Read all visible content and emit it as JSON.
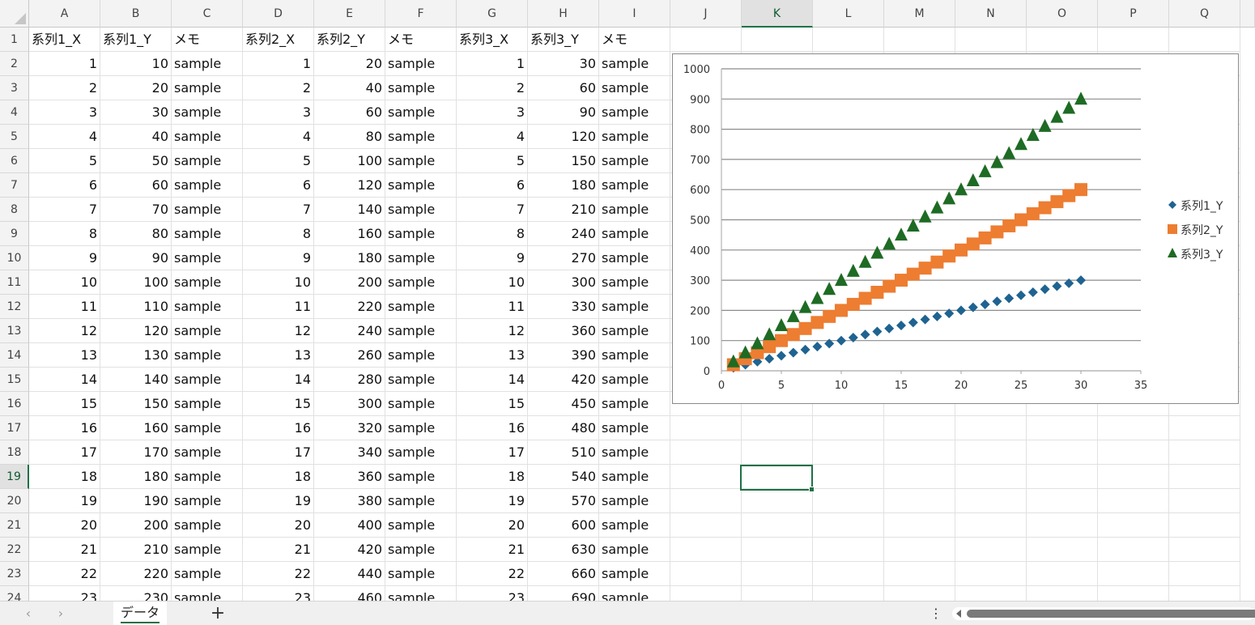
{
  "columns": [
    "A",
    "B",
    "C",
    "D",
    "E",
    "F",
    "G",
    "H",
    "I",
    "J",
    "K",
    "L",
    "M",
    "N",
    "O",
    "P",
    "Q"
  ],
  "selected_column": "K",
  "selected_row": "19",
  "rows": [
    {
      "row": "1",
      "cells": [
        "系列1_X",
        "系列1_Y",
        "メモ",
        "系列2_X",
        "系列2_Y",
        "メモ",
        "系列3_X",
        "系列3_Y",
        "メモ"
      ]
    },
    {
      "row": "2",
      "cells": [
        "1",
        "10",
        "sample",
        "1",
        "20",
        "sample",
        "1",
        "30",
        "sample"
      ]
    },
    {
      "row": "3",
      "cells": [
        "2",
        "20",
        "sample",
        "2",
        "40",
        "sample",
        "2",
        "60",
        "sample"
      ]
    },
    {
      "row": "4",
      "cells": [
        "3",
        "30",
        "sample",
        "3",
        "60",
        "sample",
        "3",
        "90",
        "sample"
      ]
    },
    {
      "row": "5",
      "cells": [
        "4",
        "40",
        "sample",
        "4",
        "80",
        "sample",
        "4",
        "120",
        "sample"
      ]
    },
    {
      "row": "6",
      "cells": [
        "5",
        "50",
        "sample",
        "5",
        "100",
        "sample",
        "5",
        "150",
        "sample"
      ]
    },
    {
      "row": "7",
      "cells": [
        "6",
        "60",
        "sample",
        "6",
        "120",
        "sample",
        "6",
        "180",
        "sample"
      ]
    },
    {
      "row": "8",
      "cells": [
        "7",
        "70",
        "sample",
        "7",
        "140",
        "sample",
        "7",
        "210",
        "sample"
      ]
    },
    {
      "row": "9",
      "cells": [
        "8",
        "80",
        "sample",
        "8",
        "160",
        "sample",
        "8",
        "240",
        "sample"
      ]
    },
    {
      "row": "10",
      "cells": [
        "9",
        "90",
        "sample",
        "9",
        "180",
        "sample",
        "9",
        "270",
        "sample"
      ]
    },
    {
      "row": "11",
      "cells": [
        "10",
        "100",
        "sample",
        "10",
        "200",
        "sample",
        "10",
        "300",
        "sample"
      ]
    },
    {
      "row": "12",
      "cells": [
        "11",
        "110",
        "sample",
        "11",
        "220",
        "sample",
        "11",
        "330",
        "sample"
      ]
    },
    {
      "row": "13",
      "cells": [
        "12",
        "120",
        "sample",
        "12",
        "240",
        "sample",
        "12",
        "360",
        "sample"
      ]
    },
    {
      "row": "14",
      "cells": [
        "13",
        "130",
        "sample",
        "13",
        "260",
        "sample",
        "13",
        "390",
        "sample"
      ]
    },
    {
      "row": "15",
      "cells": [
        "14",
        "140",
        "sample",
        "14",
        "280",
        "sample",
        "14",
        "420",
        "sample"
      ]
    },
    {
      "row": "16",
      "cells": [
        "15",
        "150",
        "sample",
        "15",
        "300",
        "sample",
        "15",
        "450",
        "sample"
      ]
    },
    {
      "row": "17",
      "cells": [
        "16",
        "160",
        "sample",
        "16",
        "320",
        "sample",
        "16",
        "480",
        "sample"
      ]
    },
    {
      "row": "18",
      "cells": [
        "17",
        "170",
        "sample",
        "17",
        "340",
        "sample",
        "17",
        "510",
        "sample"
      ]
    },
    {
      "row": "19",
      "cells": [
        "18",
        "180",
        "sample",
        "18",
        "360",
        "sample",
        "18",
        "540",
        "sample"
      ]
    },
    {
      "row": "20",
      "cells": [
        "19",
        "190",
        "sample",
        "19",
        "380",
        "sample",
        "19",
        "570",
        "sample"
      ]
    },
    {
      "row": "21",
      "cells": [
        "20",
        "200",
        "sample",
        "20",
        "400",
        "sample",
        "20",
        "600",
        "sample"
      ]
    },
    {
      "row": "22",
      "cells": [
        "21",
        "210",
        "sample",
        "21",
        "420",
        "sample",
        "21",
        "630",
        "sample"
      ]
    },
    {
      "row": "23",
      "cells": [
        "22",
        "220",
        "sample",
        "22",
        "440",
        "sample",
        "22",
        "660",
        "sample"
      ]
    },
    {
      "row": "24",
      "cells": [
        "23",
        "230",
        "sample",
        "23",
        "460",
        "sample",
        "23",
        "690",
        "sample"
      ]
    }
  ],
  "tabs": {
    "sheet_name": "データ",
    "prev_icon": "‹",
    "next_icon": "›",
    "add_label": "+",
    "more_icon": "⋮"
  },
  "chart_data": {
    "type": "scatter",
    "title": "",
    "xlabel": "",
    "ylabel": "",
    "xlim": [
      0,
      35
    ],
    "ylim": [
      0,
      1000
    ],
    "xticks": [
      0,
      5,
      10,
      15,
      20,
      25,
      30,
      35
    ],
    "yticks": [
      0,
      100,
      200,
      300,
      400,
      500,
      600,
      700,
      800,
      900,
      1000
    ],
    "grid": "horizontal",
    "legend_position": "right",
    "series": [
      {
        "name": "系列1_Y",
        "marker": "diamond",
        "color": "#1f6391",
        "x": [
          1,
          2,
          3,
          4,
          5,
          6,
          7,
          8,
          9,
          10,
          11,
          12,
          13,
          14,
          15,
          16,
          17,
          18,
          19,
          20,
          21,
          22,
          23,
          24,
          25,
          26,
          27,
          28,
          29,
          30
        ],
        "y": [
          10,
          20,
          30,
          40,
          50,
          60,
          70,
          80,
          90,
          100,
          110,
          120,
          130,
          140,
          150,
          160,
          170,
          180,
          190,
          200,
          210,
          220,
          230,
          240,
          250,
          260,
          270,
          280,
          290,
          300
        ]
      },
      {
        "name": "系列2_Y",
        "marker": "square",
        "color": "#ed7d31",
        "x": [
          1,
          2,
          3,
          4,
          5,
          6,
          7,
          8,
          9,
          10,
          11,
          12,
          13,
          14,
          15,
          16,
          17,
          18,
          19,
          20,
          21,
          22,
          23,
          24,
          25,
          26,
          27,
          28,
          29,
          30
        ],
        "y": [
          20,
          40,
          60,
          80,
          100,
          120,
          140,
          160,
          180,
          200,
          220,
          240,
          260,
          280,
          300,
          320,
          340,
          360,
          380,
          400,
          420,
          440,
          460,
          480,
          500,
          520,
          540,
          560,
          580,
          600
        ]
      },
      {
        "name": "系列3_Y",
        "marker": "triangle",
        "color": "#1e6b24",
        "x": [
          1,
          2,
          3,
          4,
          5,
          6,
          7,
          8,
          9,
          10,
          11,
          12,
          13,
          14,
          15,
          16,
          17,
          18,
          19,
          20,
          21,
          22,
          23,
          24,
          25,
          26,
          27,
          28,
          29,
          30
        ],
        "y": [
          30,
          60,
          90,
          120,
          150,
          180,
          210,
          240,
          270,
          300,
          330,
          360,
          390,
          420,
          450,
          480,
          510,
          540,
          570,
          600,
          630,
          660,
          690,
          720,
          750,
          780,
          810,
          840,
          870,
          900
        ]
      }
    ]
  }
}
